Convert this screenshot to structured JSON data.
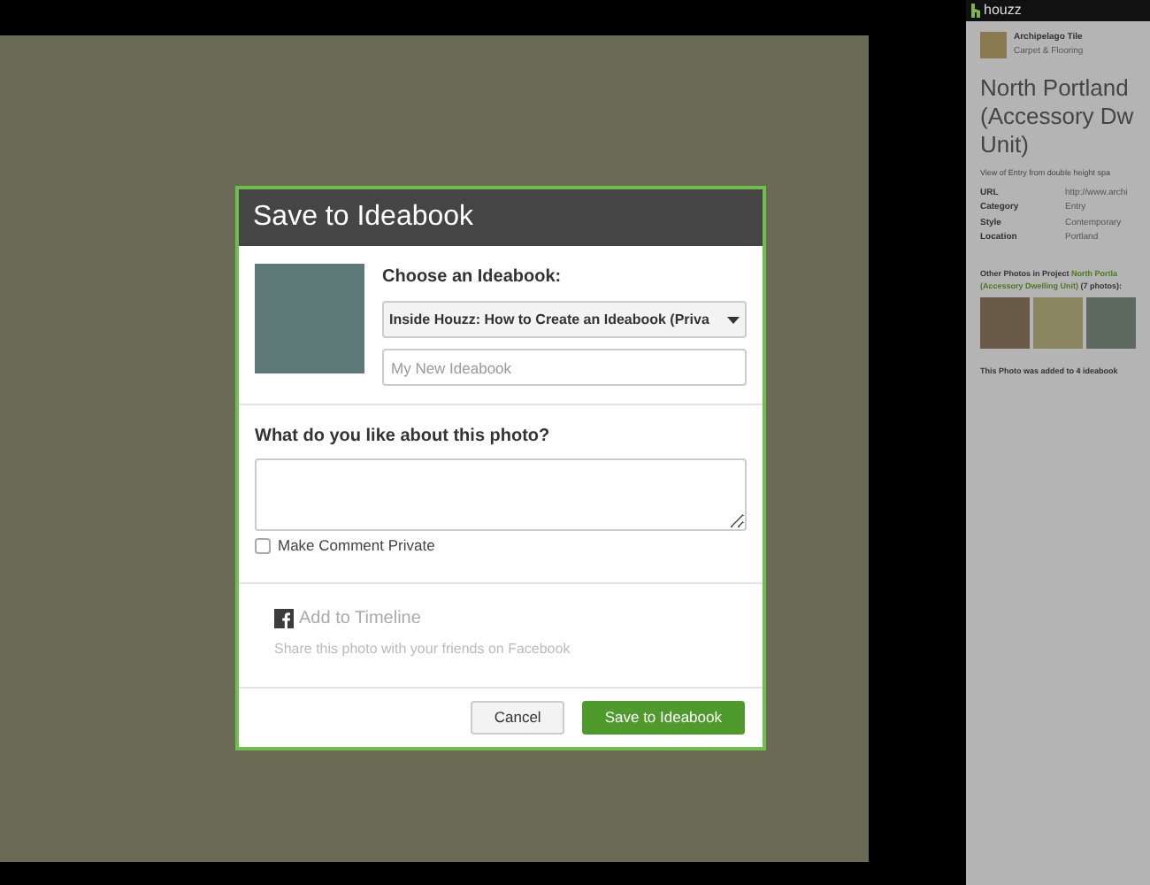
{
  "dialog": {
    "title": "Save to Ideabook",
    "choose_label": "Choose an Ideabook:",
    "ideabook_select": {
      "value": "Inside Houzz: How to Create an Ideabook (Priva"
    },
    "new_ideabook": {
      "placeholder": "My New Ideabook"
    },
    "comment_label": "What do you like about this photo?",
    "private_checkbox": {
      "label": "Make Comment Private",
      "checked": false
    },
    "timeline": {
      "title": "Add to Timeline",
      "description": "Share this photo with your friends on Facebook"
    },
    "buttons": [
      {
        "label": "Cancel",
        "kind": "secondary"
      },
      {
        "label": "Save to Ideabook",
        "kind": "primary"
      }
    ]
  },
  "sidebar": {
    "logo": "houzz",
    "pro": {
      "name": "Archipelago Tile",
      "category": "Carpet & Flooring"
    },
    "title_lines": [
      "North Portland",
      "(Accessory Dw",
      "Unit)"
    ],
    "caption": "View of Entry from double height spa",
    "details": [
      {
        "label": "URL",
        "value": "http://www.archi"
      },
      {
        "label": "Category",
        "value": "Entry"
      },
      {
        "label": "Style",
        "value": "Contemporary"
      },
      {
        "label": "Location",
        "value": "Portland"
      }
    ],
    "other_photos": {
      "prefix": "Other Photos in Project ",
      "project_lines": [
        "North Portla",
        "(Accessory Dwelling Unit)"
      ],
      "count": " (7 photos):"
    },
    "added_note": "This Photo was added to 4 ideabook"
  }
}
